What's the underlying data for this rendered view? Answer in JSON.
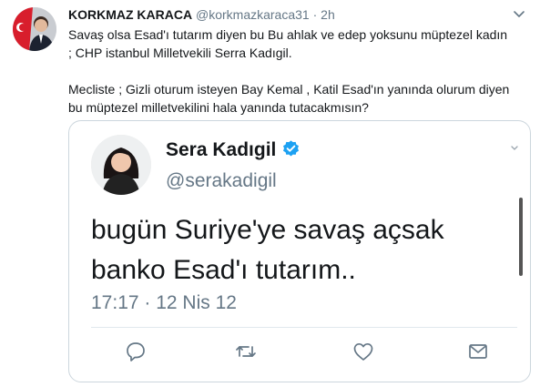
{
  "author": {
    "name": "KORKMAZ KARACA",
    "handle": "@korkmazkaraca31",
    "separator": "·",
    "time": "2h"
  },
  "tweet": {
    "line1": "Savaş olsa Esad'ı tutarım diyen bu Bu ahlak ve edep yoksunu müptezel kadın",
    "line2": ";  CHP istanbul Milletvekili Serra Kadıgil.",
    "line3": "Mecliste ; Gizli oturum isteyen Bay Kemal , Katil Esad'ın yanında olurum diyen",
    "line4": "bu müptezel milletvekilini hala yanında tutacakmısın?"
  },
  "quoted": {
    "name": "Sera Kadıgil",
    "handle": "@serakadigil",
    "text_line1": "bugün Suriye'ye savaş açsak",
    "text_line2": "banko Esad'ı tutarım..",
    "timestamp": "17:17 · 12 Nis 12"
  },
  "icons": {
    "verified": "verified-badge-icon",
    "reply": "reply-icon",
    "retweet": "retweet-icon",
    "like": "like-icon",
    "share": "share-icon",
    "caret": "chevron-down-icon"
  },
  "colors": {
    "secondary_text": "#657786",
    "verified_blue": "#1da1f2",
    "border": "#ccd6dd"
  }
}
